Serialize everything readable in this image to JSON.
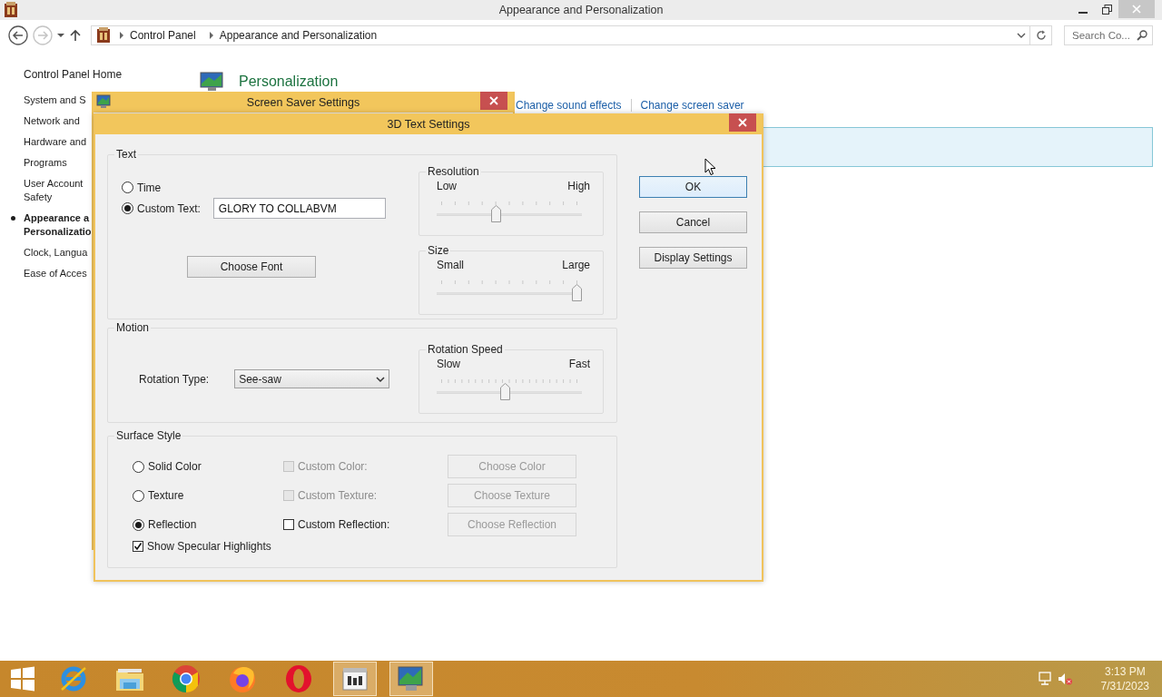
{
  "window": {
    "title": "Appearance and Personalization"
  },
  "navigation": {
    "back": {
      "disabled": false
    },
    "forward": {
      "disabled": true
    }
  },
  "address_bar": {
    "crumbs": [
      "Control Panel",
      "Appearance and Personalization"
    ]
  },
  "search": {
    "placeholder": "Search Co..."
  },
  "sidebar": {
    "home": "Control Panel Home",
    "items": [
      {
        "lines": [
          "System and S"
        ],
        "selected": false
      },
      {
        "lines": [
          "Network and"
        ],
        "selected": false
      },
      {
        "lines": [
          "Hardware and"
        ],
        "selected": false
      },
      {
        "lines": [
          "Programs"
        ],
        "selected": false
      },
      {
        "lines": [
          "User Account",
          "Safety"
        ],
        "selected": false
      },
      {
        "lines": [
          "Appearance a",
          "Personalizatio"
        ],
        "selected": true
      },
      {
        "lines": [
          "Clock, Langua"
        ],
        "selected": false
      },
      {
        "lines": [
          "Ease of Acces"
        ],
        "selected": false
      }
    ]
  },
  "content": {
    "heading": "Personalization",
    "links": [
      "Change sound effects",
      "Change screen saver"
    ]
  },
  "screen_saver_dialog": {
    "title": "Screen Saver Settings"
  },
  "text_dialog": {
    "title": "3D Text Settings",
    "text_group": {
      "title": "Text",
      "options": [
        {
          "label": "Time",
          "selected": false
        },
        {
          "label": "Custom Text:",
          "selected": true
        }
      ],
      "custom_text": "GLORY TO COLLABVM",
      "choose_font": "Choose Font",
      "sliders": [
        {
          "title": "Resolution",
          "min_label": "Low",
          "max_label": "High",
          "level": 0.4
        },
        {
          "title": "Size",
          "min_label": "Small",
          "max_label": "Large",
          "level": 1
        }
      ]
    },
    "motion": {
      "title": "Motion",
      "rotation_type_label": "Rotation Type:",
      "rotation_type": "See-saw",
      "slider": {
        "title": "Rotation Speed",
        "min_label": "Slow",
        "max_label": "Fast",
        "level": 0.47
      }
    },
    "surface": {
      "title": "Surface Style",
      "rows": [
        {
          "label": "Solid Color",
          "selected": false,
          "custom": {
            "label": "Custom Color:",
            "checked": false,
            "disabled": true
          },
          "button": {
            "label": "Choose Color",
            "disabled": true
          }
        },
        {
          "label": "Texture",
          "selected": false,
          "custom": {
            "label": "Custom Texture:",
            "checked": false,
            "disabled": true
          },
          "button": {
            "label": "Choose Texture",
            "disabled": true
          }
        },
        {
          "label": "Reflection",
          "selected": true,
          "custom": {
            "label": "Custom Reflection:",
            "checked": false,
            "disabled": false
          },
          "button": {
            "label": "Choose Reflection",
            "disabled": true
          }
        }
      ],
      "specular": {
        "label": "Show Specular Highlights",
        "checked": true
      }
    },
    "buttons": [
      {
        "label": "OK",
        "default": true
      },
      {
        "label": "Cancel",
        "default": false
      },
      {
        "label": "Display Settings",
        "default": false
      }
    ]
  },
  "taskbar": {
    "apps": [
      {
        "kind": "start",
        "active": false
      },
      {
        "kind": "ie",
        "active": false
      },
      {
        "kind": "explorer",
        "active": false
      },
      {
        "kind": "chrome",
        "active": false
      },
      {
        "kind": "firefox",
        "active": false
      },
      {
        "kind": "opera",
        "active": false
      },
      {
        "kind": "controlpanel",
        "active": true
      },
      {
        "kind": "screensaver",
        "active": true
      }
    ],
    "tray": {
      "muted": true,
      "time": "3:13 PM",
      "date": "7/31/2023"
    }
  }
}
